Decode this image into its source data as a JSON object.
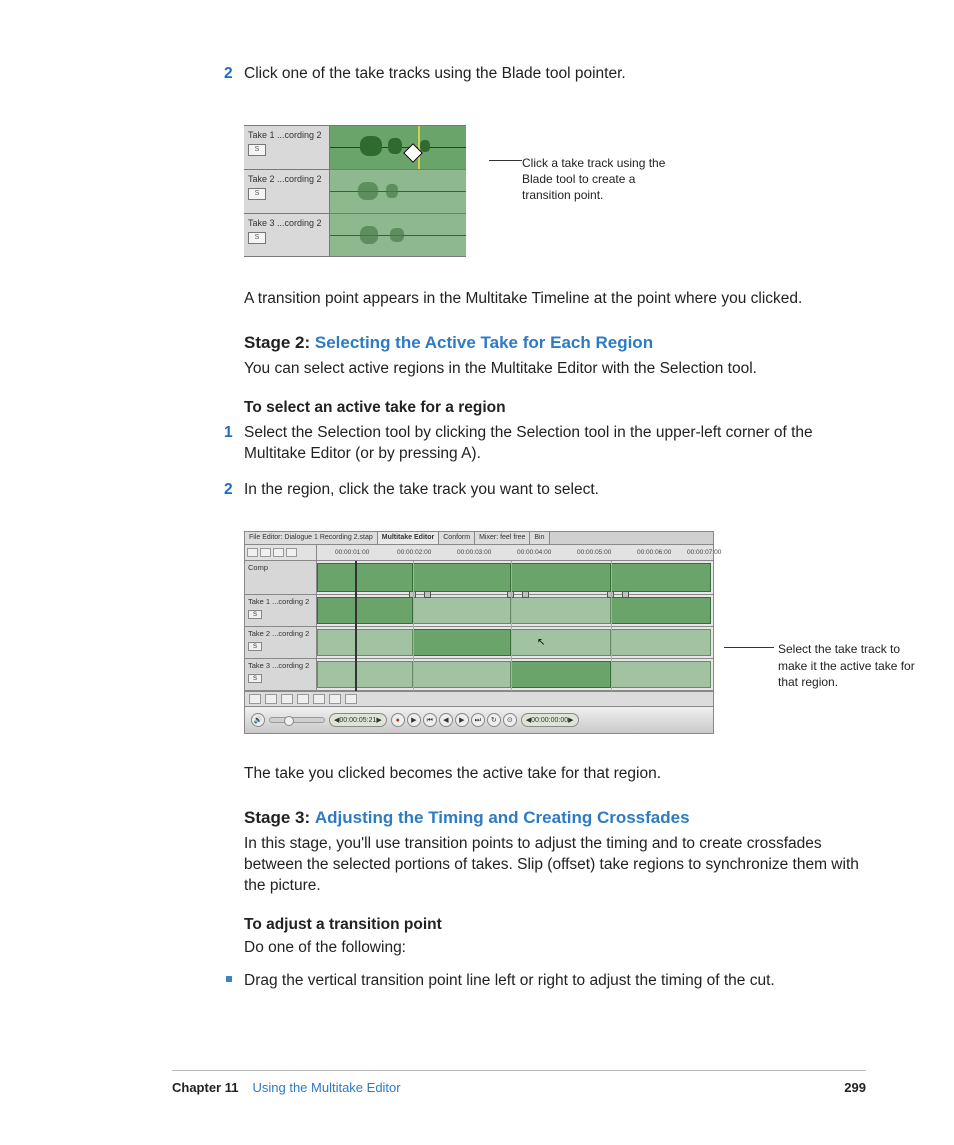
{
  "step2": {
    "num": "2",
    "text": "Click one of the take tracks using the Blade tool pointer."
  },
  "fig1": {
    "takes": [
      {
        "label": "Take 1 ...cording 2",
        "solo": "S"
      },
      {
        "label": "Take 2 ...cording 2",
        "solo": "S"
      },
      {
        "label": "Take 3 ...cording 2",
        "solo": "S"
      }
    ],
    "callout": "Click a take track using the Blade tool to create a transition point."
  },
  "para1": "A transition point appears in the Multitake Timeline at the point where you clicked.",
  "stage2": {
    "label": "Stage 2:",
    "title": "Selecting the Active Take for Each Region",
    "intro": "You can select active regions in the Multitake Editor with the Selection tool.",
    "subhead": "To select an active take for a region"
  },
  "s2step1": {
    "num": "1",
    "text": "Select the Selection tool by clicking the Selection tool in the upper-left corner of the Multitake Editor (or by pressing A)."
  },
  "s2step2": {
    "num": "2",
    "text": "In the region, click the take track you want to select."
  },
  "fig2": {
    "tabs": [
      "File Editor: Dialogue 1 Recording 2.stap",
      "Multitake Editor",
      "Conform",
      "Mixer: feel free",
      "Bin"
    ],
    "times": [
      "00:00:01:00",
      "00:00:02:00",
      "00:00:03:00",
      "00:00:04:00",
      "00:00:05:00",
      "00:00:06:00",
      "00:00:07:00"
    ],
    "tracks": [
      {
        "label": "Comp",
        "solo": ""
      },
      {
        "label": "Take 1 ...cording 2",
        "solo": "S"
      },
      {
        "label": "Take 2 ...cording 2",
        "solo": "S"
      },
      {
        "label": "Take 3 ...cording 2",
        "solo": "S"
      }
    ],
    "lcd1": "00:00:05:21",
    "lcd2": "00:00:00:00",
    "callout": "Select the take track to make it the active take for that region."
  },
  "para2": "The take you clicked becomes the active take for that region.",
  "stage3": {
    "label": "Stage 3:",
    "title": "Adjusting the Timing and Creating Crossfades",
    "intro": "In this stage, you'll use transition points to adjust the timing and to create crossfades between the selected portions of takes. Slip (offset) take regions to synchronize them with the picture.",
    "subhead": "To adjust a transition point",
    "sub2": "Do one of the following:"
  },
  "bullet1": "Drag the vertical transition point line left or right to adjust the timing of the cut.",
  "footer": {
    "chapter": "Chapter 11",
    "title": "Using the Multitake Editor",
    "page": "299"
  }
}
